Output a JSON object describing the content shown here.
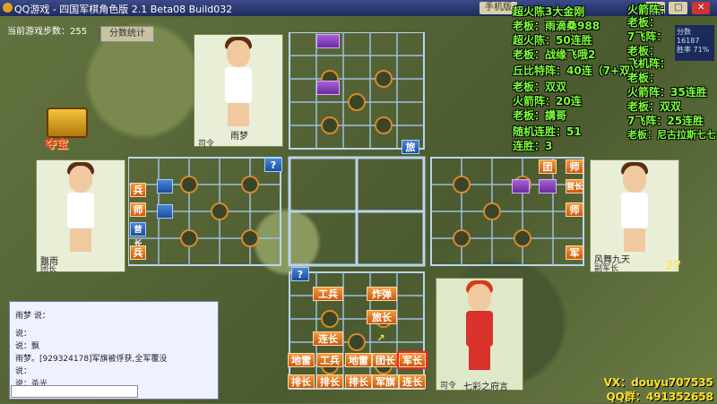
{
  "window": {
    "title": "QQ游戏 - 四国军棋角色版 2.1 Beta08 Build032",
    "buttons": [
      "手机版",
      "—",
      "□",
      "✕"
    ]
  },
  "game": {
    "steps_label": "当前游戏步数：255",
    "stats_button": "分数统计",
    "treasure_label": "夺宝"
  },
  "players": {
    "top": {
      "name": "雨梦",
      "rank": "司令"
    },
    "left": {
      "name": "飘雨",
      "rank": "团长"
    },
    "right": {
      "name": "风舞九天",
      "rank": "副军长",
      "score": "27"
    },
    "bottom": {
      "name": "七彩之府言",
      "rank": "司令"
    }
  },
  "top_right_mini": {
    "line1": "分数 16187",
    "line2": "胜率 71%"
  },
  "board": {
    "top_pieces": [
      {
        "label": "",
        "color": "purple"
      },
      {
        "label": "",
        "color": "purple"
      },
      {
        "label": "旅",
        "color": "blue"
      }
    ],
    "left_pieces": [
      "兵",
      "师",
      "营长",
      "兵"
    ],
    "left_unknown": "?",
    "right_pieces": [
      "团",
      "师",
      "营长",
      "师",
      "军"
    ],
    "bottom_unknown": "?",
    "bottom_pieces": [
      {
        "label": "工兵"
      },
      {
        "label": "炸弹"
      },
      {
        "label": "旅长"
      },
      {
        "label": "连长"
      },
      {
        "label": "↗"
      },
      {
        "label": "地雷"
      },
      {
        "label": "工兵"
      },
      {
        "label": "地雷"
      },
      {
        "label": "团长"
      },
      {
        "label": "军长"
      },
      {
        "label": "排长"
      },
      {
        "label": "排长"
      },
      {
        "label": "排长"
      },
      {
        "label": "军旗"
      },
      {
        "label": "连长"
      }
    ]
  },
  "overlay_text": {
    "left_col": [
      "超火陈3大金刚",
      "老板：雨滴桑988",
      "超火陈：50连胜",
      "老板：战缘飞哦2",
      "丘比特阵：40连（7+双）",
      "老板：双双",
      "火箭阵：20连",
      "老板：講哥",
      "随机连胜：51",
      "连胜：3"
    ],
    "right_col": [
      "火箭阵：",
      "老板：",
      "7飞阵：",
      "老板：",
      "飞机阵：",
      "老板：",
      "火箭阵：35连胜",
      "老板：双双",
      "7飞阵：25连胜",
      "老板：尼古拉斯七七"
    ]
  },
  "chat": {
    "lines": [
      "雨梦  说：",
      "",
      "              说：",
      "              说：飘",
      "雨梦。[929324178]军旗被俘获,全军覆没",
      "              说：",
      "              说：杀光"
    ]
  },
  "footer": {
    "vx": "VX：douyu707535",
    "qq": "QQ群：491352658"
  },
  "colors": {
    "accent_green": "#7dff3a",
    "piece_orange": "#e8781f",
    "piece_blue": "#2d62b8",
    "piece_purple": "#8a44c0"
  }
}
